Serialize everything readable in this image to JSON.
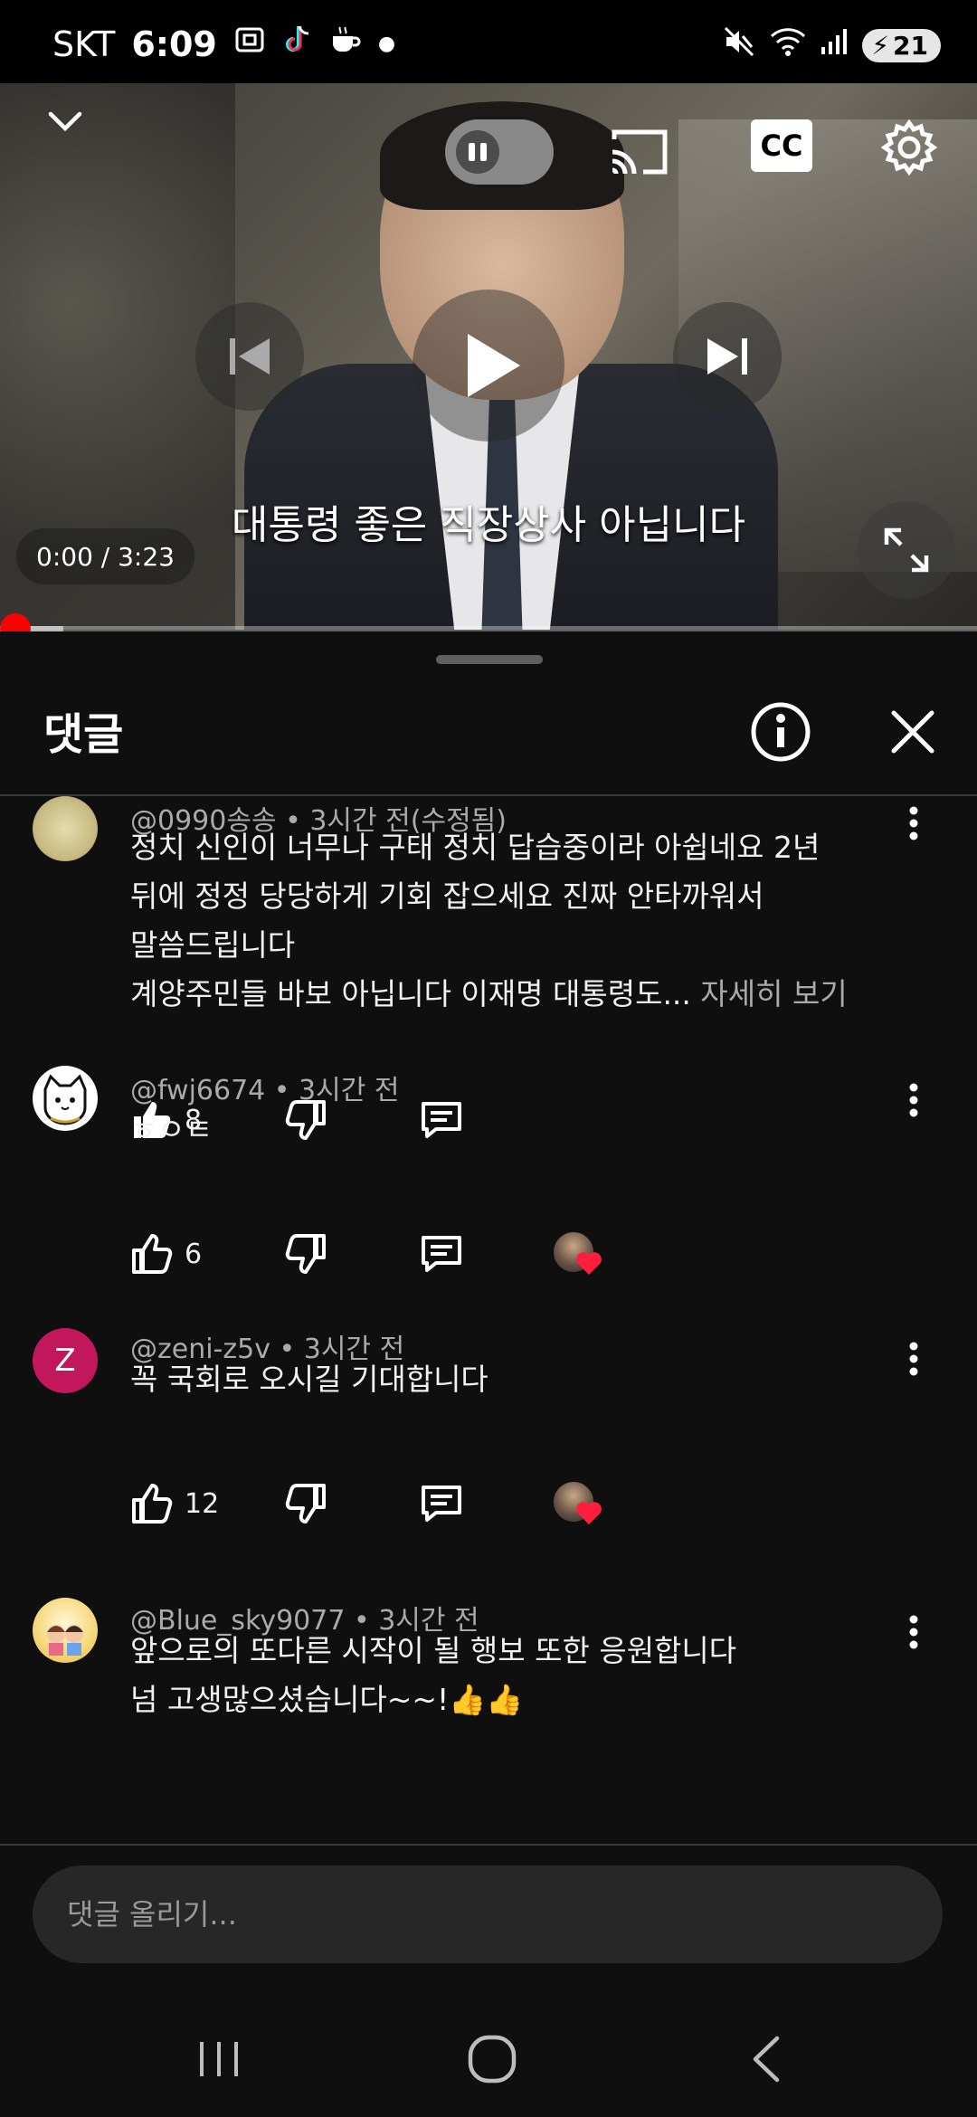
{
  "status_bar": {
    "carrier": "SKT",
    "time": "6:09",
    "battery_level": "21"
  },
  "video": {
    "subtitle": "대통령 좋은 직장상사 아닙니다",
    "time_display": "0:00 / 3:23",
    "progress_fraction": 0,
    "buffered_fraction": 0.065
  },
  "comments_panel": {
    "title": "댓글",
    "comments": [
      {
        "author": "@0990송송",
        "time": "3시간 전(수정됨)",
        "text": "정치 신인이 너무나 구태 정치 답습중이라 아쉽네요 2년\n뒤에 정정 당당하게 기회 잡으세요 진짜 안타까워서\n말씀드립니다\n계양주민들 바보 아닙니다 이재명 대통령도...",
        "read_more": "자세히 보기",
        "likes": "8",
        "creator_heart": false
      },
      {
        "author": "@fwj6674",
        "time": "3시간 전",
        "text": "ㅎㅇㅌ",
        "likes": "6",
        "creator_heart": true
      },
      {
        "author": "@zeni-z5v",
        "time": "3시간 전",
        "avatar_letter": "Z",
        "avatar_color": "#c2185b",
        "text": "꼭 국회로 오시길 기대합니다",
        "likes": "12",
        "creator_heart": true
      },
      {
        "author": "@Blue_sky9077",
        "time": "3시간 전",
        "text": "앞으로의 또다른 시작이 될 행보 또한 응원합니다\n넘 고생많으셨습니다~~!👍👍",
        "likes": "",
        "creator_heart": false
      }
    ]
  },
  "comment_input": {
    "placeholder": "댓글 올리기..."
  },
  "colors": {
    "accent": "#ff0000",
    "background": "#0f0f0f",
    "secondary_text": "#aaaaaa",
    "heart": "#ff1f3d"
  }
}
